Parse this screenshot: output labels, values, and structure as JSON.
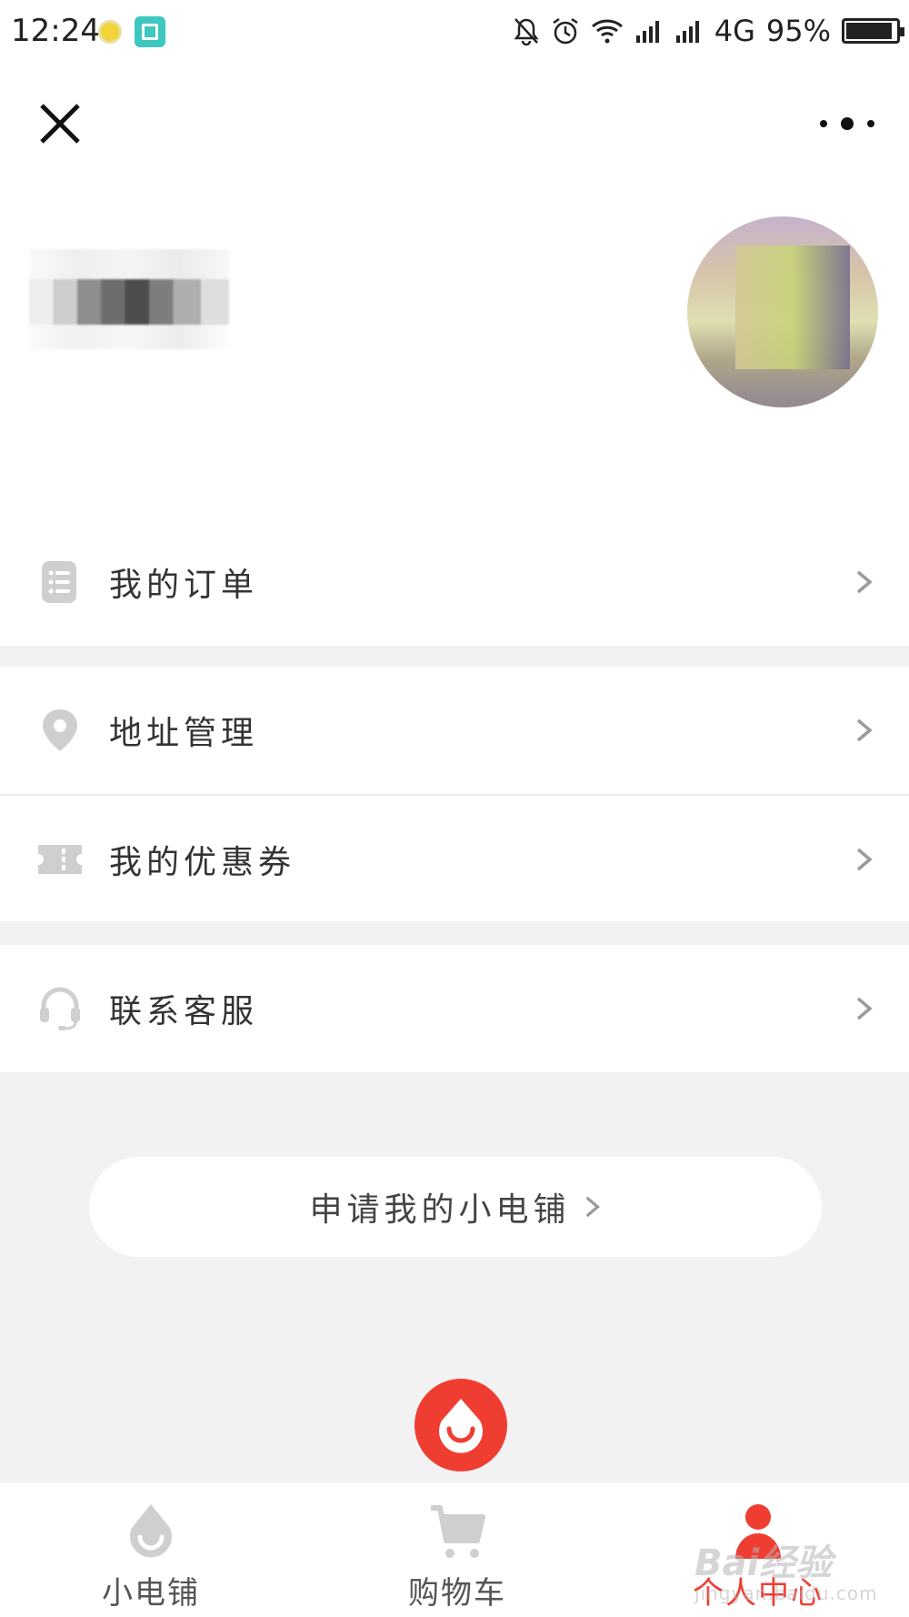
{
  "status_bar": {
    "time": "12:24",
    "network": "4G",
    "battery": "95%"
  },
  "header": {
    "close_icon": "close-icon",
    "more_icon": "more-icon"
  },
  "menu": {
    "orders": "我的订单",
    "address": "地址管理",
    "coupons": "我的优惠券",
    "service": "联系客服"
  },
  "apply_button": {
    "label": "申请我的小电铺"
  },
  "tabbar": {
    "items": [
      {
        "label": "小电铺",
        "icon": "shop-drop-icon",
        "active": false
      },
      {
        "label": "购物车",
        "icon": "cart-icon",
        "active": false
      },
      {
        "label": "个人中心",
        "icon": "person-icon",
        "active": true
      }
    ]
  },
  "watermark": {
    "text": "Bai",
    "suffix": "经验",
    "sub": "jingyan.baidu.com"
  },
  "colors": {
    "accent": "#f03d32",
    "background": "#f2f2f2",
    "icon_gray": "#cfcfcf"
  }
}
